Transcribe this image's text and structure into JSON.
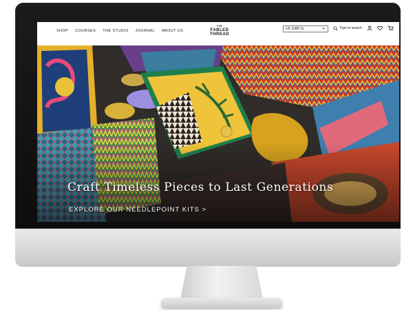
{
  "nav": {
    "links": [
      "SHOP",
      "COURSES",
      "THE STUDIO",
      "JOURNAL",
      "ABOUT US"
    ]
  },
  "logo": {
    "line1": "THE",
    "line2": "FABLED",
    "line3": "THREAD"
  },
  "currency": {
    "value": "UK (GBP £)"
  },
  "search": {
    "label": "Type to search"
  },
  "icons": [
    "search-icon",
    "account-icon",
    "wishlist-icon",
    "cart-icon",
    "chevron-down-icon"
  ],
  "hero": {
    "title": "Craft Timeless Pieces to Last Generations",
    "cta": "EXPLORE OUR NEEDLEPOINT KITS >"
  },
  "colors": {
    "bezel": "#111112",
    "chin": "#dcdcde",
    "hero_text": "#ffffff"
  }
}
